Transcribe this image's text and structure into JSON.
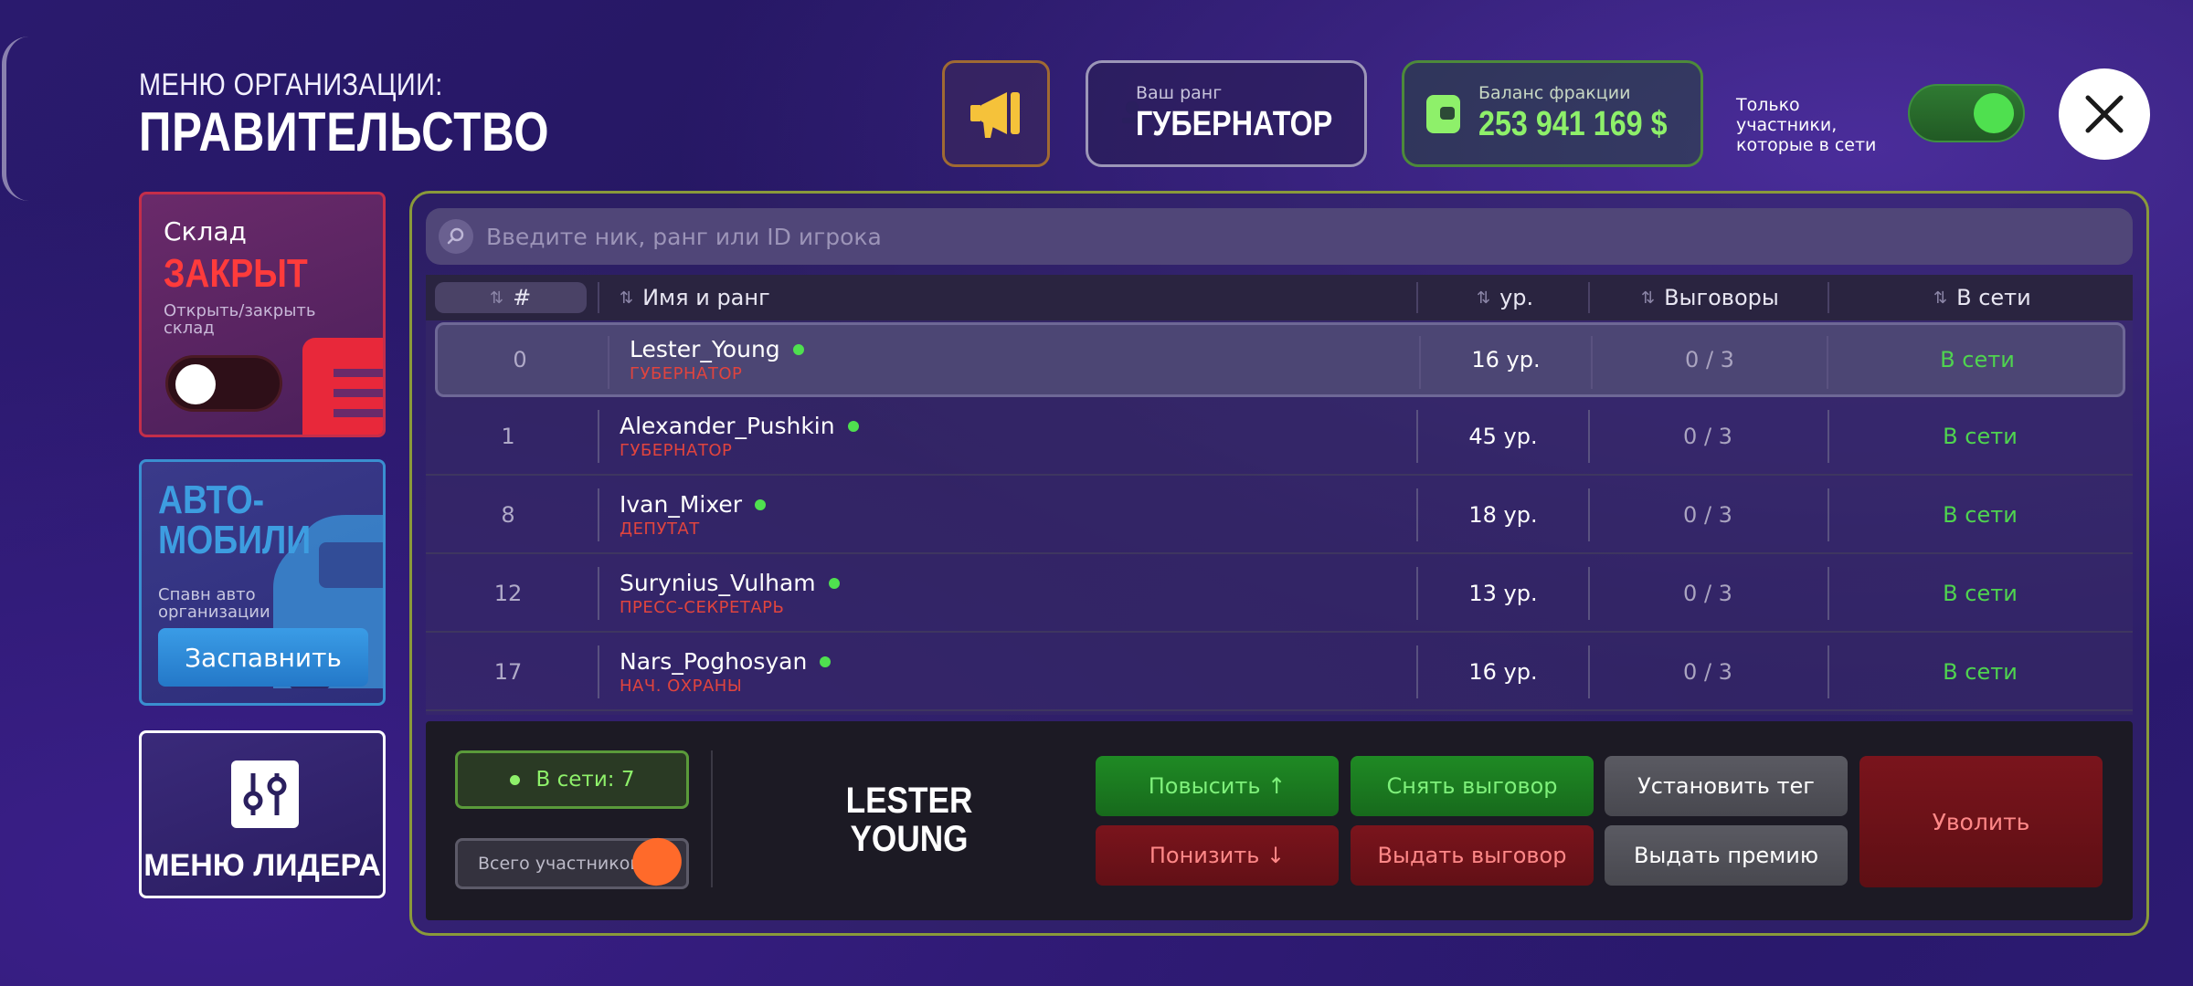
{
  "header": {
    "subtitle": "МЕНЮ ОРГАНИЗАЦИИ:",
    "title": "ПРАВИТЕЛЬСТВО",
    "rank_label": "Ваш ранг",
    "rank_value": "ГУБЕРНАТОР",
    "balance_label": "Баланс фракции",
    "balance_value": "253 941 169 $",
    "online_only_label": "Только участники, которые в сети",
    "online_only_enabled": true
  },
  "sidebar": {
    "warehouse": {
      "title": "Склад",
      "status": "ЗАКРЫТ",
      "description": "Открыть/закрыть склад",
      "toggle_on": false
    },
    "cars": {
      "title": "АВТО- МОБИЛИ",
      "description": "Спавн авто организации",
      "button": "Заспавнить"
    },
    "leader_menu": {
      "label": "МЕНЮ ЛИДЕРА"
    }
  },
  "search": {
    "placeholder": "Введите ник, ранг или ID игрока",
    "value": ""
  },
  "table": {
    "columns": {
      "num": "#",
      "name": "Имя и ранг",
      "level": "ур.",
      "warnings": "Выговоры",
      "online": "В сети"
    },
    "rows": [
      {
        "num": "0",
        "name": "Lester_Young",
        "rank": "ГУБЕРНАТОР",
        "level": "16 ур.",
        "warnings": "0 / 3",
        "online": "В сети",
        "selected": true
      },
      {
        "num": "1",
        "name": "Alexander_Pushkin",
        "rank": "ГУБЕРНАТОР",
        "level": "45 ур.",
        "warnings": "0 / 3",
        "online": "В сети",
        "selected": false
      },
      {
        "num": "8",
        "name": "Ivan_Mixer",
        "rank": "ДЕПУТАТ",
        "level": "18 ур.",
        "warnings": "0 / 3",
        "online": "В сети",
        "selected": false
      },
      {
        "num": "12",
        "name": "Surynius_Vulham",
        "rank": "ПРЕСС-СЕКРЕТАРЬ",
        "level": "13 ур.",
        "warnings": "0 / 3",
        "online": "В сети",
        "selected": false
      },
      {
        "num": "17",
        "name": "Nars_Poghosyan",
        "rank": "НАЧ. ОХРАНЫ",
        "level": "16 ур.",
        "warnings": "0 / 3",
        "online": "В сети",
        "selected": false
      }
    ]
  },
  "footer": {
    "online_count": "В сети: 7",
    "total_members": "Всего участников:",
    "selected_player": "LESTER YOUNG",
    "actions": {
      "promote": "Повысить ↑",
      "remove_warning": "Снять выговор",
      "set_tag": "Установить тег",
      "demote": "Понизить ↓",
      "give_warning": "Выдать выговор",
      "give_bonus": "Выдать премию",
      "fire": "Уволить"
    }
  },
  "colors": {
    "accent_green": "#4fe04f",
    "accent_red": "#ff3b3b",
    "rank_red": "#e0443e",
    "balance_green": "#8ef06a",
    "cars_blue": "#3d9de0"
  }
}
